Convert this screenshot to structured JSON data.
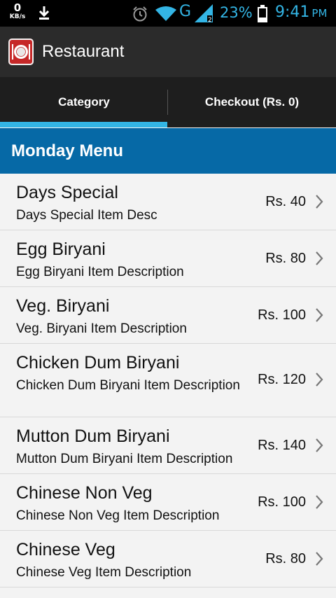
{
  "status_bar": {
    "speed_value": "0",
    "speed_unit": "KB/s",
    "network": "G",
    "battery_percent": "23%",
    "time": "9:41",
    "ampm": "PM",
    "icons": [
      "download-icon",
      "alarm-icon",
      "wifi-icon",
      "signal-icon",
      "battery-icon"
    ],
    "accent_color": "#33b5e5"
  },
  "action_bar": {
    "title": "Restaurant",
    "icon": "restaurant-plate-icon",
    "icon_color": "#c62828"
  },
  "tabs": [
    {
      "label": "Category",
      "selected": true
    },
    {
      "label": "Checkout (Rs. 0)",
      "selected": false
    }
  ],
  "section": {
    "title": "Monday Menu",
    "color": "#0669a6"
  },
  "menu_items": [
    {
      "name": "Days Special",
      "description": "Days Special Item Desc",
      "price": "Rs. 40"
    },
    {
      "name": "Egg Biryani",
      "description": "Egg Biryani Item Description",
      "price": "Rs. 80"
    },
    {
      "name": "Veg. Biryani",
      "description": "Veg. Biryani Item Description",
      "price": "Rs. 100"
    },
    {
      "name": "Chicken Dum Biryani",
      "description": "Chicken Dum Biryani Item Description",
      "price": "Rs. 120"
    },
    {
      "name": "Mutton Dum Biryani",
      "description": "Mutton Dum Biryani Item Description",
      "price": "Rs. 140"
    },
    {
      "name": "Chinese Non Veg",
      "description": "Chinese Non Veg Item Description",
      "price": "Rs. 100"
    },
    {
      "name": "Chinese Veg",
      "description": "Chinese Veg Item Description",
      "price": "Rs. 80"
    }
  ]
}
